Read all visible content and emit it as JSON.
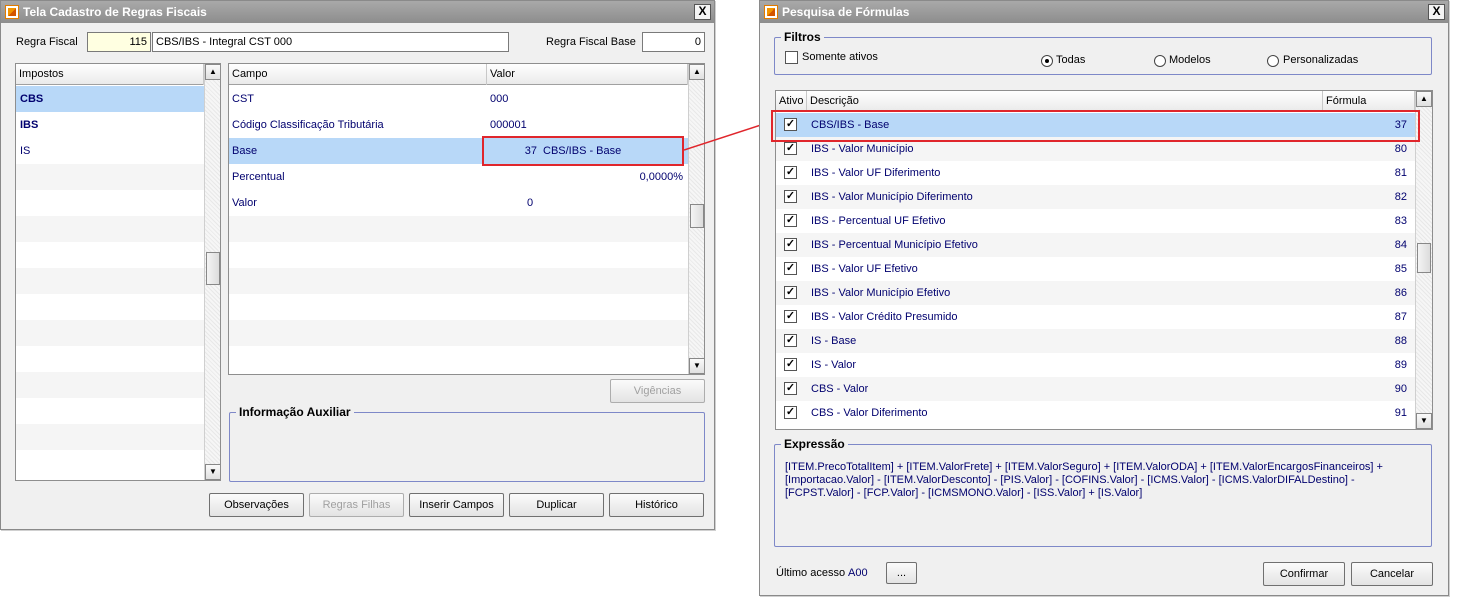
{
  "left_window": {
    "title": "Tela Cadastro de Regras Fiscais",
    "close_label": "X",
    "regra_fiscal_label": "Regra Fiscal",
    "regra_fiscal_code": "115",
    "regra_fiscal_desc": "CBS/IBS - Integral CST 000",
    "regra_fiscal_base_label": "Regra Fiscal Base",
    "regra_fiscal_base_value": "0",
    "impostos_header": "Impostos",
    "impostos": [
      "CBS",
      "IBS",
      "IS"
    ],
    "campo_header": "Campo",
    "valor_header": "Valor",
    "campos": [
      {
        "campo": "CST",
        "valor": "000"
      },
      {
        "campo": "Código Classificação Tributária",
        "valor": "000001"
      },
      {
        "campo": "Base",
        "valor_num": "37",
        "valor_desc": "CBS/IBS - Base"
      },
      {
        "campo": "Percentual",
        "valor": "0,0000%"
      },
      {
        "campo": "Valor",
        "valor": "0"
      }
    ],
    "vigencias_label": "Vigências",
    "info_aux_label": "Informação Auxiliar",
    "buttons": {
      "observacoes": "Observações",
      "regras_filhas": "Regras Filhas",
      "inserir_campos": "Inserir Campos",
      "duplicar": "Duplicar",
      "historico": "Histórico"
    }
  },
  "right_window": {
    "title": "Pesquisa de Fórmulas",
    "close_label": "X",
    "filtros_label": "Filtros",
    "somente_ativos_label": "Somente ativos",
    "radio_todas": "Todas",
    "radio_modelos": "Modelos",
    "radio_personalizadas": "Personalizadas",
    "col_ativo": "Ativo",
    "col_descricao": "Descrição",
    "col_formula": "Fórmula",
    "rows": [
      {
        "descricao": "CBS/IBS - Base",
        "formula": "37"
      },
      {
        "descricao": "IBS - Valor Município",
        "formula": "80"
      },
      {
        "descricao": "IBS - Valor UF Diferimento",
        "formula": "81"
      },
      {
        "descricao": "IBS - Valor Município Diferimento",
        "formula": "82"
      },
      {
        "descricao": "IBS - Percentual UF Efetivo",
        "formula": "83"
      },
      {
        "descricao": "IBS - Percentual Município Efetivo",
        "formula": "84"
      },
      {
        "descricao": "IBS - Valor UF Efetivo",
        "formula": "85"
      },
      {
        "descricao": "IBS - Valor Município Efetivo",
        "formula": "86"
      },
      {
        "descricao": "IBS - Valor Crédito Presumido",
        "formula": "87"
      },
      {
        "descricao": "IS - Base",
        "formula": "88"
      },
      {
        "descricao": "IS - Valor",
        "formula": "89"
      },
      {
        "descricao": "CBS - Valor",
        "formula": "90"
      },
      {
        "descricao": "CBS - Valor Diferimento",
        "formula": "91"
      }
    ],
    "expressao_label": "Expressão",
    "expressao_text": "[ITEM.PrecoTotalItem] + [ITEM.ValorFrete] + [ITEM.ValorSeguro] + [ITEM.ValorODA] + [ITEM.ValorEncargosFinanceiros] + [Importacao.Valor] - [ITEM.ValorDesconto] - [PIS.Valor] - [COFINS.Valor] - [ICMS.Valor] - [ICMS.ValorDIFALDestino] - [FCPST.Valor] - [FCP.Valor] - [ICMSMONO.Valor] - [ISS.Valor] + [IS.Valor]",
    "ultimo_acesso_label": "Último acesso",
    "ultimo_acesso_value": "A00",
    "ellipsis_label": "...",
    "confirmar_label": "Confirmar",
    "cancelar_label": "Cancelar"
  },
  "colors": {
    "highlight_red": "#e0262c",
    "selected_row": "#b8d8f8",
    "text_blue": "#00006e"
  }
}
